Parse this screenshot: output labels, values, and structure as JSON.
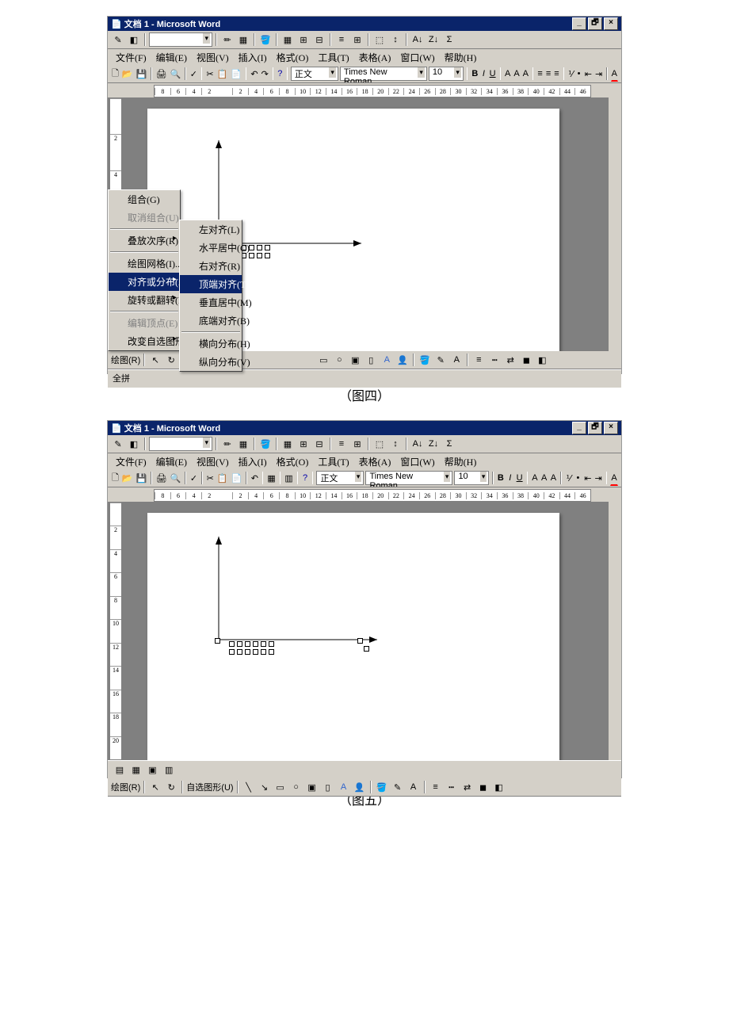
{
  "title": "文档 1 - Microsoft Word",
  "menus": [
    "文件(F)",
    "编辑(E)",
    "视图(V)",
    "插入(I)",
    "格式(O)",
    "工具(T)",
    "表格(A)",
    "窗口(W)",
    "帮助(H)"
  ],
  "style_combo": "正文",
  "font_combo": "Times New Roman",
  "size_combo": "10",
  "ruler_h": [
    "8",
    "6",
    "4",
    "2",
    "",
    "2",
    "4",
    "6",
    "8",
    "10",
    "12",
    "14",
    "16",
    "18",
    "20",
    "22",
    "24",
    "26",
    "28",
    "30",
    "32",
    "34",
    "36",
    "38",
    "40",
    "42",
    "44",
    "46"
  ],
  "ruler_v": [
    "",
    "2",
    "4",
    "6",
    "8",
    "10",
    "12"
  ],
  "ruler_v2": [
    "",
    "2",
    "4",
    "6",
    "8",
    "10",
    "12",
    "14",
    "16",
    "18",
    "20"
  ],
  "ctx1": {
    "group": "组合(G)",
    "ungroup": "取消组合(U)",
    "order": "叠放次序(R)",
    "grid": "绘图网格(I)...",
    "align": "对齐或分布(A)",
    "rotate": "旋转或翻转(P)",
    "edit_points": "编辑顶点(E)",
    "change_shape": "改变自选图形(C)"
  },
  "ctx2": {
    "left": "左对齐(L)",
    "center_h": "水平居中(C)",
    "right": "右对齐(R)",
    "top": "顶端对齐(T)",
    "center_v": "垂直居中(M)",
    "bottom": "底端对齐(B)",
    "dist_h": "横向分布(H)",
    "dist_v": "纵向分布(V)"
  },
  "draw_label": "绘图(R)",
  "autoshapes": "自选图形(U)",
  "caption4": "（图四）",
  "caption5": "（图五）",
  "ime": "全拼"
}
